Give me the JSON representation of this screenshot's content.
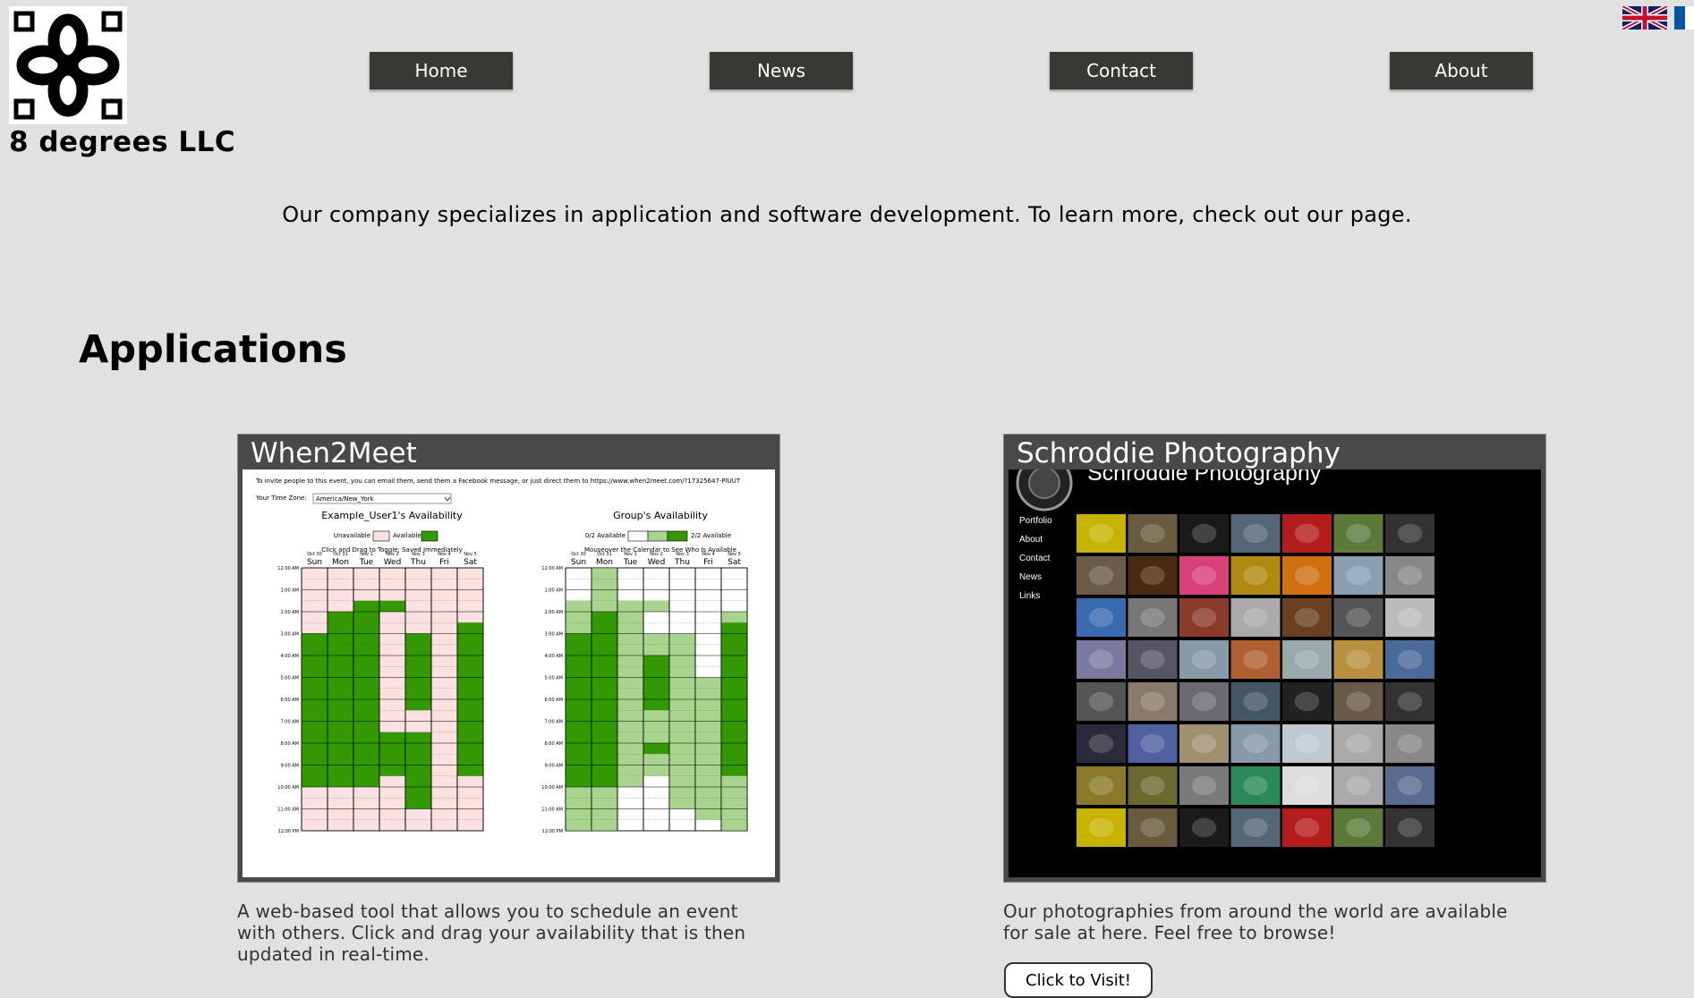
{
  "brand": {
    "name": "8 degrees LLC"
  },
  "nav": [
    {
      "label": "Home"
    },
    {
      "label": "News"
    },
    {
      "label": "Contact"
    },
    {
      "label": "About"
    }
  ],
  "tagline": "Our company specializes in application and software development. To learn more, check out our page.",
  "applications": {
    "title": "Applications",
    "cards": [
      {
        "title": "When2Meet",
        "description": "A web-based tool that allows you to schedule an event with others. Click and drag your availability that is then updated in real-time.",
        "screenshot": {
          "invite_text": "To invite people to this event, you can email them, send them a Facebook message, or just direct them to https://www.when2meet.com/?17325647-PlUUT",
          "timezone_label": "Your Time Zone:",
          "timezone_value": "America/New_York",
          "left_title": "Example_User1's Availability",
          "left_legend_unavailable": "Unavailable",
          "left_legend_available": "Available",
          "left_hint": "Click and Drag to Toggle; Saved Immediately",
          "right_title": "Group's Availability",
          "right_legend_min": "0/2 Available",
          "right_legend_max": "2/2 Available",
          "right_hint": "Mouseover the Calendar to See Who Is Available",
          "dates": [
            "Oct 30",
            "Oct 31",
            "Nov 1",
            "Nov 2",
            "Nov 3",
            "Nov 4",
            "Nov 5"
          ],
          "days": [
            "Sun",
            "Mon",
            "Tue",
            "Wed",
            "Thu",
            "Fri",
            "Sat"
          ],
          "times": [
            "12:00 AM",
            "1:00 AM",
            "2:00 AM",
            "3:00 AM",
            "4:00 AM",
            "5:00 AM",
            "6:00 AM",
            "7:00 AM",
            "8:00 AM",
            "9:00 AM",
            "10:00 AM",
            "11:00 AM",
            "12:00 PM"
          ]
        }
      },
      {
        "title": "Schroddie Photography",
        "description": "Our photographies from around the world are available for sale at here. Feel free to browse!",
        "button": "Click to Visit!",
        "screenshot": {
          "site_title": "Schroddie Photography",
          "menu": [
            "Portfolio",
            "About",
            "Contact",
            "News",
            "Links"
          ]
        }
      }
    ]
  },
  "colors": {
    "background": "#e1e1e1",
    "nav_button": "#3a3835",
    "card_header": "#4a4848",
    "unavailable": "#fbe1e1",
    "available": "#339900",
    "group_light": "#a8d48e"
  }
}
